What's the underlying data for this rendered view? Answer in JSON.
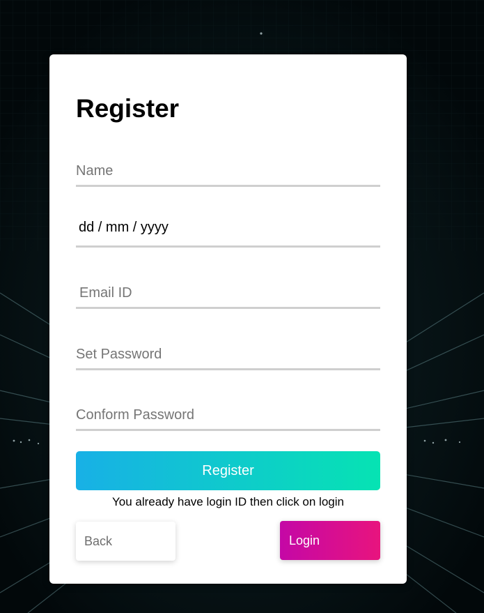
{
  "form": {
    "title": "Register",
    "name_placeholder": "Name",
    "dob_format": "dd / mm / yyyy",
    "email_placeholder": "Email ID",
    "password_placeholder": "Set Password",
    "confirm_password_placeholder": "Conform Password",
    "register_label": "Register",
    "login_hint": "You already have login ID then click on login",
    "back_label": "Back",
    "login_label": "Login"
  },
  "colors": {
    "register_gradient_start": "#18b0e6",
    "register_gradient_end": "#06e3b3",
    "login_gradient_start": "#c408a6",
    "login_gradient_end": "#e8147e",
    "background": "#03090b",
    "card": "#ffffff"
  }
}
